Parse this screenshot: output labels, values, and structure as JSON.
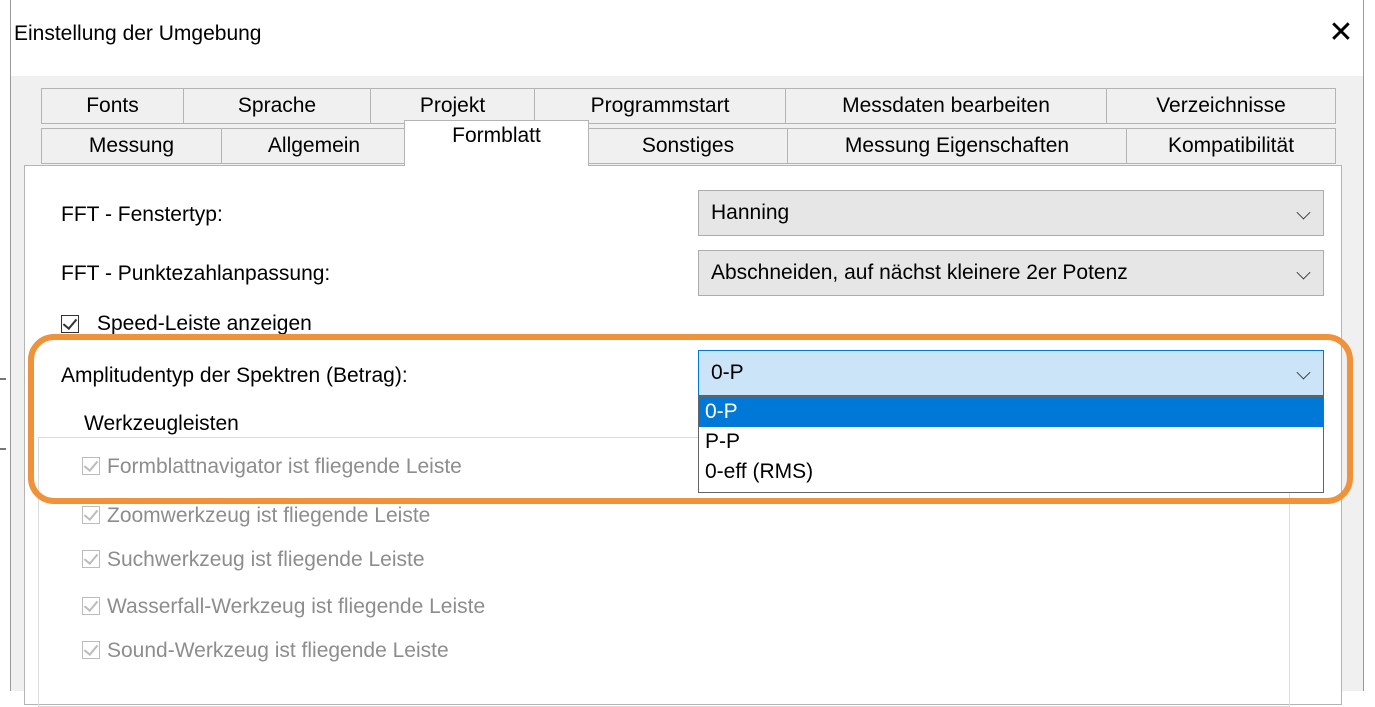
{
  "window": {
    "title": "Einstellung der Umgebung"
  },
  "tabs_row1": [
    "Fonts",
    "Sprache",
    "Projekt",
    "Programmstart",
    "Messdaten bearbeiten",
    "Verzeichnisse"
  ],
  "tabs_row2": [
    "Messung",
    "Allgemein",
    "Formblatt",
    "Sonstiges",
    "Messung Eigenschaften",
    "Kompatibilität"
  ],
  "active_tab": "Formblatt",
  "settings": {
    "fft_window_label": "FFT - Fenstertyp:",
    "fft_window_value": "Hanning",
    "fft_points_label": "FFT - Punktezahlanpassung:",
    "fft_points_value": "Abschneiden, auf nächst kleinere 2er Potenz",
    "speed_bar_label": "Speed-Leiste anzeigen",
    "amplitude_label": "Amplitudentyp der Spektren (Betrag):",
    "amplitude_value": "0-P",
    "amplitude_options": [
      "0-P",
      "P-P",
      "0-eff (RMS)"
    ]
  },
  "toolbars": {
    "group_label": "Werkzeugleisten",
    "items": [
      "Formblattnavigator ist fliegende Leiste",
      "Zoomwerkzeug ist fliegende Leiste",
      "Suchwerkzeug ist fliegende Leiste",
      "Wasserfall-Werkzeug ist fliegende Leiste",
      "Sound-Werkzeug ist fliegende Leiste"
    ]
  },
  "colors": {
    "highlight": "#f0923a",
    "selection": "#0078d7",
    "focus_fill": "#cce4f7"
  }
}
